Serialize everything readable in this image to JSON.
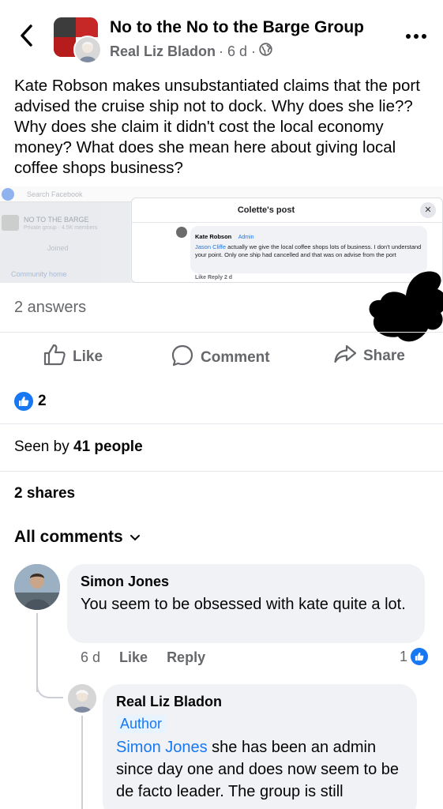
{
  "header": {
    "group_name": "No to the No to the Barge Group",
    "author": "Real Liz Bladon",
    "time": "· 6 d ·",
    "icons": [
      "back-arrow-icon",
      "globe-icon",
      "more-dots-icon"
    ]
  },
  "post": {
    "text": "Kate Robson makes unsubstantiated claims that the port advised the cruise ship not to dock. Why does she lie?? Why does she claim it didn't cost the local economy money? What does she mean here about giving local coffee shops business?"
  },
  "screenshot": {
    "search_placeholder": "Search Facebook",
    "group_label": "NO TO THE BARGE",
    "group_sub": "Private group · 4.5K members",
    "joined": "Joined",
    "community_home": "Community home",
    "modal_title": "Colette's post",
    "comment_author": "Kate Robson",
    "comment_badge": "Admin",
    "comment_mention": "Jason Cliffe",
    "comment_text": " actually we give the local coffee shops lots of business. I don't understand your point. Only one ship had cancelled and that was on advise from the port",
    "comment_actions": "Like   Reply   2 d"
  },
  "answers": "2 answers",
  "actions": {
    "like": "Like",
    "comment": "Comment",
    "share": "Share"
  },
  "reactions": {
    "count": "2"
  },
  "seen_by": {
    "prefix": "Seen by ",
    "count": "41 people"
  },
  "shares": "2 shares",
  "all_comments": "All comments",
  "comments": [
    {
      "author": "Simon Jones",
      "text": "You seem to be obsessed with kate quite a lot.",
      "time": "6 d",
      "like": "Like",
      "reply": "Reply",
      "reactions": "1"
    },
    {
      "author": "Real Liz Bladon",
      "badge": "Author",
      "mention": "Simon Jones",
      "text": " she has been an admin since day one and does now seem to be de facto leader. The group is still"
    }
  ],
  "colors": {
    "accent": "#1877f2",
    "secondary_text": "#65676b",
    "bubble": "#f0f2f5"
  }
}
